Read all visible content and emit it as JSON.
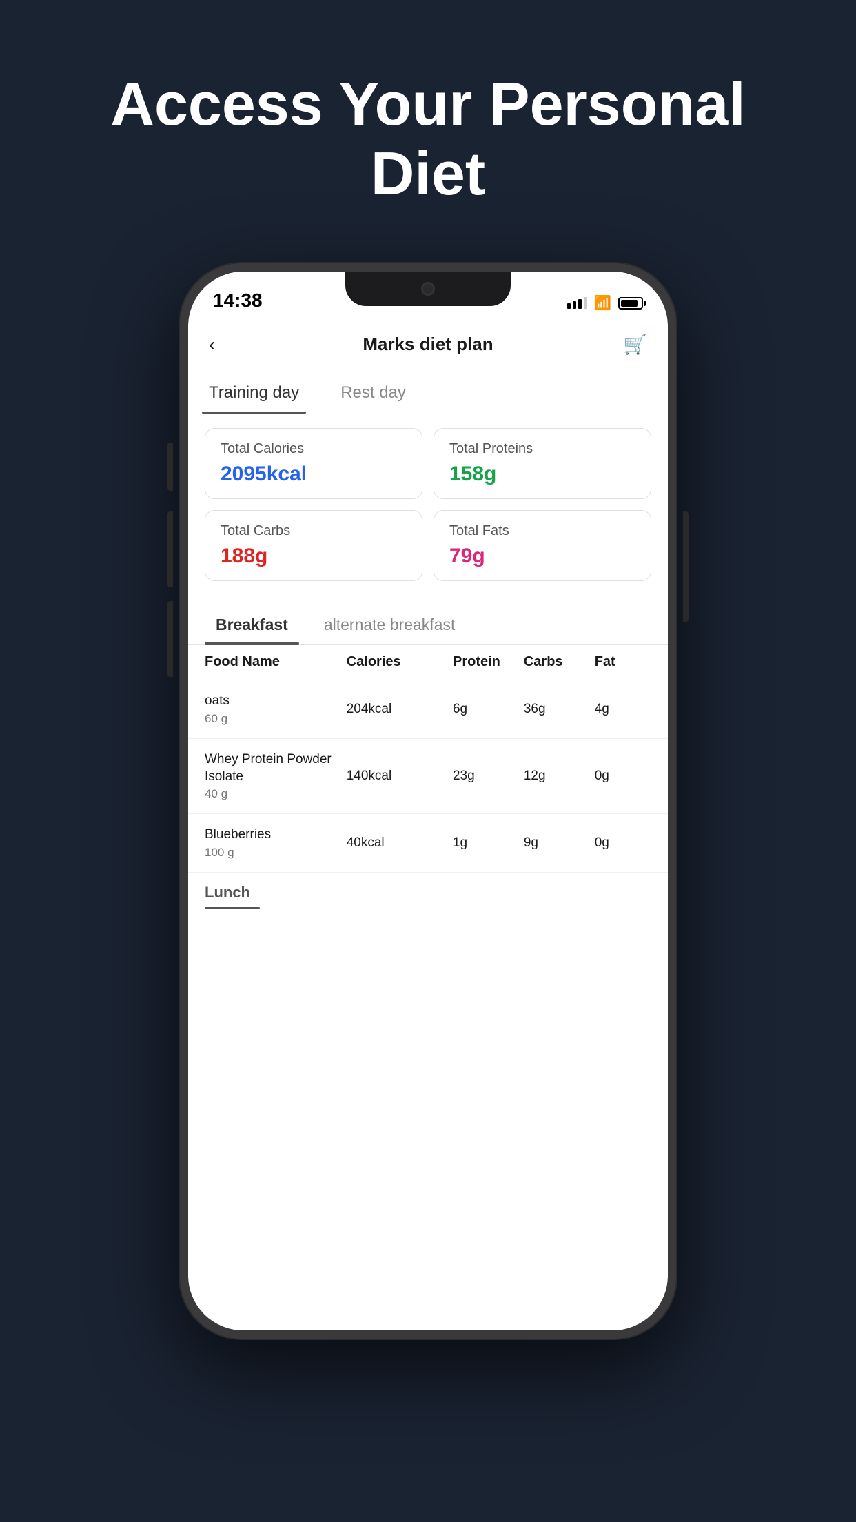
{
  "hero": {
    "title": "Access Your Personal Diet"
  },
  "statusBar": {
    "time": "14:38",
    "signal_bars": [
      4,
      6,
      8,
      10
    ],
    "battery_level": "85%"
  },
  "nav": {
    "title": "Marks diet plan",
    "back_label": "<",
    "cart_label": "🛒"
  },
  "day_tabs": [
    {
      "label": "Training day",
      "active": true
    },
    {
      "label": "Rest day",
      "active": false
    }
  ],
  "stats": [
    {
      "label": "Total Calories",
      "value": "2095kcal",
      "color_class": "blue"
    },
    {
      "label": "Total Proteins",
      "value": "158g",
      "color_class": "green"
    },
    {
      "label": "Total Carbs",
      "value": "188g",
      "color_class": "red"
    },
    {
      "label": "Total Fats",
      "value": "79g",
      "color_class": "pink"
    }
  ],
  "meal_tabs": [
    {
      "label": "Breakfast",
      "active": true
    },
    {
      "label": "alternate breakfast",
      "active": false
    }
  ],
  "table_headers": {
    "food_name": "Food Name",
    "calories": "Calories",
    "protein": "Protein",
    "carbs": "Carbs",
    "fat": "Fat"
  },
  "food_items": [
    {
      "name": "oats",
      "amount": "60 g",
      "calories": "204kcal",
      "protein": "6g",
      "carbs": "36g",
      "fat": "4g"
    },
    {
      "name": "Whey Protein Powder Isolate",
      "amount": "40 g",
      "calories": "140kcal",
      "protein": "23g",
      "carbs": "12g",
      "fat": "0g"
    },
    {
      "name": "Blueberries",
      "amount": "100 g",
      "calories": "40kcal",
      "protein": "1g",
      "carbs": "9g",
      "fat": "0g"
    }
  ],
  "next_section": {
    "label": "Lunch"
  }
}
